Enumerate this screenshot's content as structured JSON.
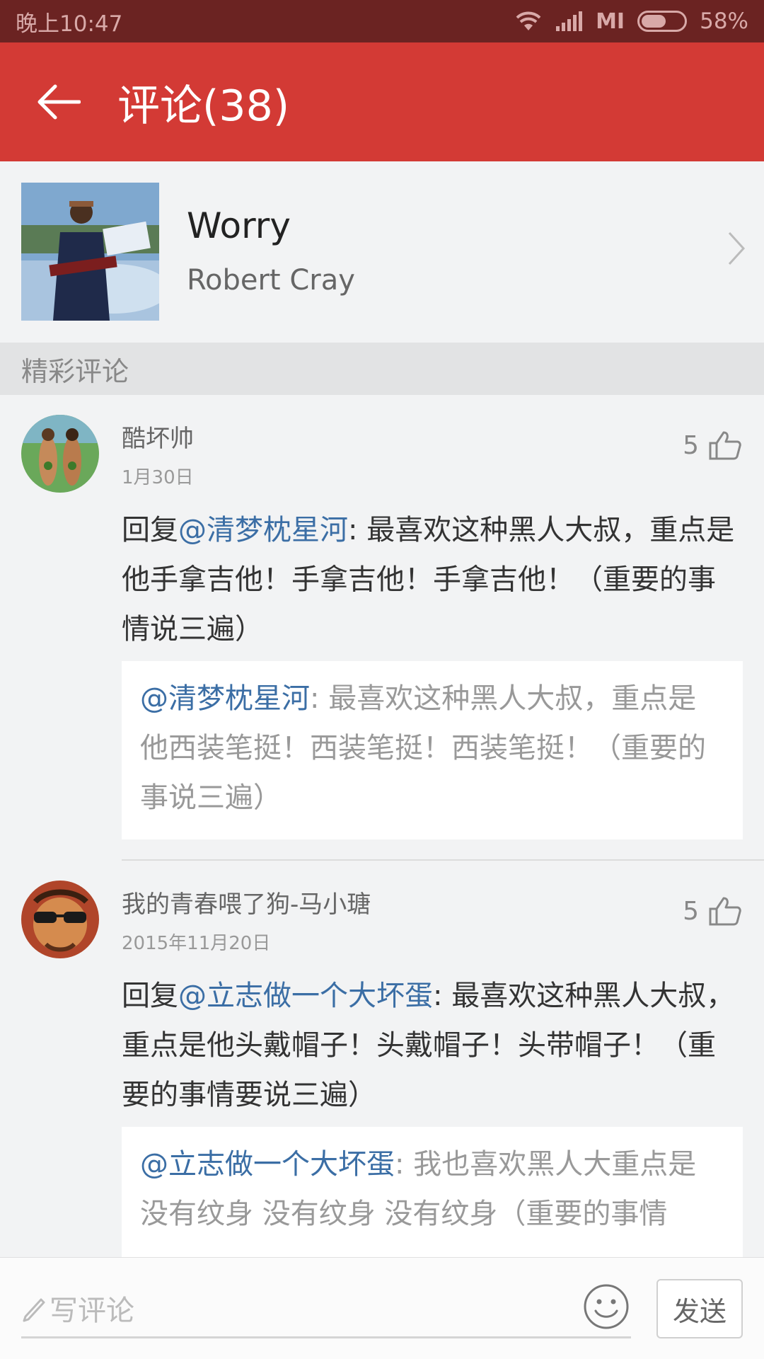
{
  "status_bar": {
    "time": "晚上10:47",
    "carrier": "MI",
    "battery_label": "58%",
    "battery_level": 0.58
  },
  "header": {
    "title": "评论(38)",
    "back_icon": "back-arrow-icon"
  },
  "song": {
    "title": "Worry",
    "artist": "Robert Cray"
  },
  "section": {
    "title": "精彩评论"
  },
  "comments": [
    {
      "user": "酷坏帅",
      "date": "1月30日",
      "likes": "5",
      "reply_prefix": "回复",
      "reply_to": "@清梦枕星河",
      "text": ": 最喜欢这种黑人大叔，重点是他手拿吉他！手拿吉他！手拿吉他！（重要的事情说三遍）",
      "quote_user": "@清梦枕星河",
      "quote_text": ": 最喜欢这种黑人大叔，重点是他西装笔挺！西装笔挺！西装笔挺！（重要的事说三遍）"
    },
    {
      "user": "我的青春喂了狗-马小瑭",
      "date": "2015年11月20日",
      "likes": "5",
      "reply_prefix": "回复",
      "reply_to": "@立志做一个大坏蛋",
      "text": ": 最喜欢这种黑人大叔，重点是他头戴帽子！头戴帽子！头带帽子！（重要的事情要说三遍）",
      "quote_user": "@立志做一个大坏蛋",
      "quote_text": ": 我也喜欢黑人大重点是没有纹身  没有纹身  没有纹身（重要的事情"
    }
  ],
  "input": {
    "placeholder": "写评论",
    "send_label": "发送"
  },
  "colors": {
    "header_red": "#d33a35",
    "status_bar": "#6b2322",
    "mention_blue": "#3b6ea5"
  }
}
